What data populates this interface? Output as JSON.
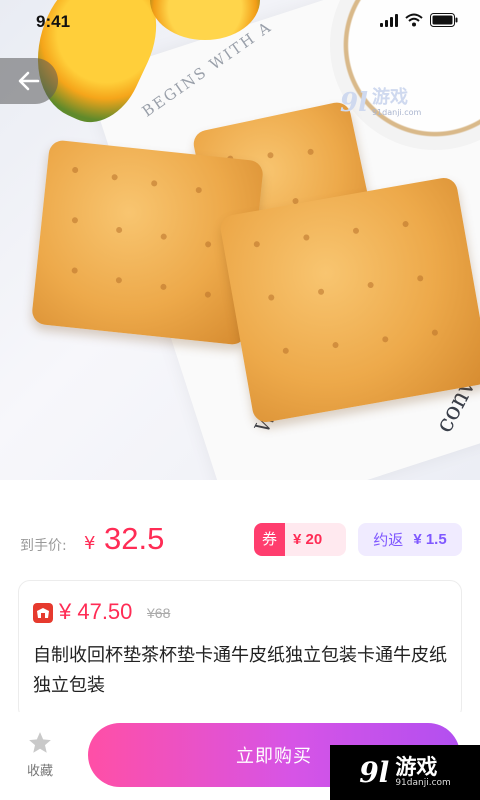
{
  "status_bar": {
    "time": "9:41"
  },
  "hero": {
    "paper_text_1": "BEGINS WITH A",
    "paper_text_2": "conver",
    "paper_text_3": "W"
  },
  "watermark": {
    "mark": "9l",
    "name": "游戏",
    "domain": "91danji.com"
  },
  "price": {
    "label": "到手价:",
    "currency": "¥",
    "value": "32.5",
    "coupon_tag": "券",
    "coupon_value": "¥ 20",
    "rebate_label": "约返",
    "rebate_value": "¥ 1.5"
  },
  "product": {
    "current_price": "¥ 47.50",
    "original_price": "¥68",
    "title": "自制收回杯垫茶杯垫卡通牛皮纸独立包装卡通牛皮纸独立包装"
  },
  "bottom_bar": {
    "favorite_label": "收藏",
    "buy_label": "立即购买"
  },
  "colors": {
    "accent": "#ff2c55",
    "rebate": "#7f58ff",
    "buy_gradient_start": "#ff4fa6",
    "buy_gradient_end": "#b24ff0"
  }
}
